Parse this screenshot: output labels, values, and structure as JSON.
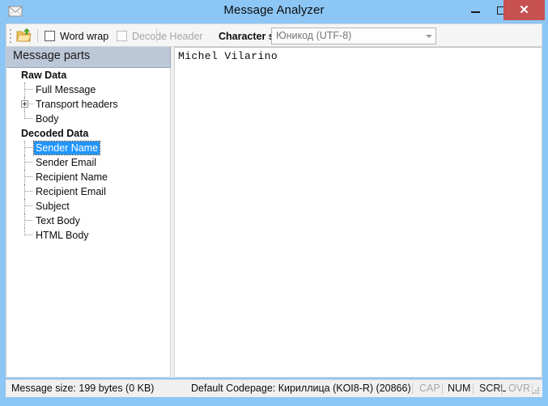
{
  "window": {
    "title": "Message Analyzer",
    "icon": "envelope-icon",
    "minimize_label": "–",
    "maximize_label": "□",
    "close_label": "✕",
    "titlebar_color": "#8cc6f4",
    "close_button_color": "#c75050"
  },
  "toolbar": {
    "open_icon": "open-folder-icon",
    "word_wrap": {
      "label": "Word wrap",
      "checked": false,
      "enabled": true
    },
    "decode_header": {
      "label": "Decode Header",
      "checked": false,
      "enabled": false
    },
    "charset": {
      "label": "Character set:",
      "value": "Юникод (UTF-8)",
      "arrow_icon": "chevron-down-icon"
    }
  },
  "tree": {
    "header": "Message parts",
    "selected": "Sender Name",
    "groups": [
      {
        "label": "Raw Data",
        "items": [
          {
            "label": "Full Message",
            "expandable": false,
            "selected": false
          },
          {
            "label": "Transport headers",
            "expandable": true,
            "selected": false
          },
          {
            "label": "Body",
            "expandable": false,
            "selected": false
          }
        ]
      },
      {
        "label": "Decoded Data",
        "items": [
          {
            "label": "Sender Name",
            "expandable": false,
            "selected": true
          },
          {
            "label": "Sender Email",
            "expandable": false,
            "selected": false
          },
          {
            "label": "Recipient Name",
            "expandable": false,
            "selected": false
          },
          {
            "label": "Recipient Email",
            "expandable": false,
            "selected": false
          },
          {
            "label": "Subject",
            "expandable": false,
            "selected": false
          },
          {
            "label": "Text Body",
            "expandable": false,
            "selected": false
          },
          {
            "label": "HTML Body",
            "expandable": false,
            "selected": false
          }
        ]
      }
    ],
    "selection_color": "#2196ff",
    "header_color": "#bcc7d8"
  },
  "content": {
    "text": "Michel Vilarino"
  },
  "statusbar": {
    "message_size": "Message size: 199 bytes (0 KB)",
    "default_codepage": "Default Codepage: Кириллица (KOI8-R) (20866)",
    "indicators": [
      {
        "label": "CAP",
        "active": false
      },
      {
        "label": "NUM",
        "active": true
      },
      {
        "label": "SCRL",
        "active": true
      },
      {
        "label": "OVR",
        "active": false
      }
    ],
    "resize_grip": "resize-grip-icon"
  }
}
